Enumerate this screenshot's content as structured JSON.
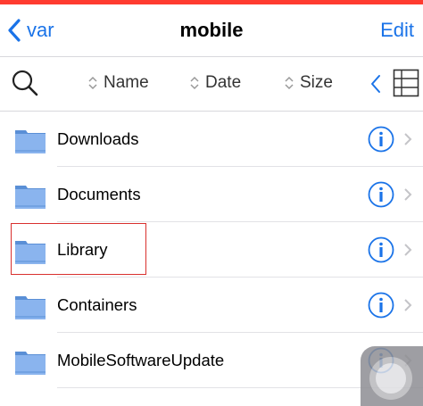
{
  "colors": {
    "accent": "#1a73e8",
    "topbar": "#ff3b30",
    "folder": "#6e9fe0",
    "highlight": "#d9302e"
  },
  "navbar": {
    "back_label": "var",
    "title": "mobile",
    "edit_label": "Edit"
  },
  "toolbar": {
    "sort_options": [
      {
        "label": "Name"
      },
      {
        "label": "Date"
      },
      {
        "label": "Size"
      }
    ]
  },
  "files": [
    {
      "name": "Downloads"
    },
    {
      "name": "Documents"
    },
    {
      "name": "Library"
    },
    {
      "name": "Containers"
    },
    {
      "name": "MobileSoftwareUpdate"
    }
  ]
}
